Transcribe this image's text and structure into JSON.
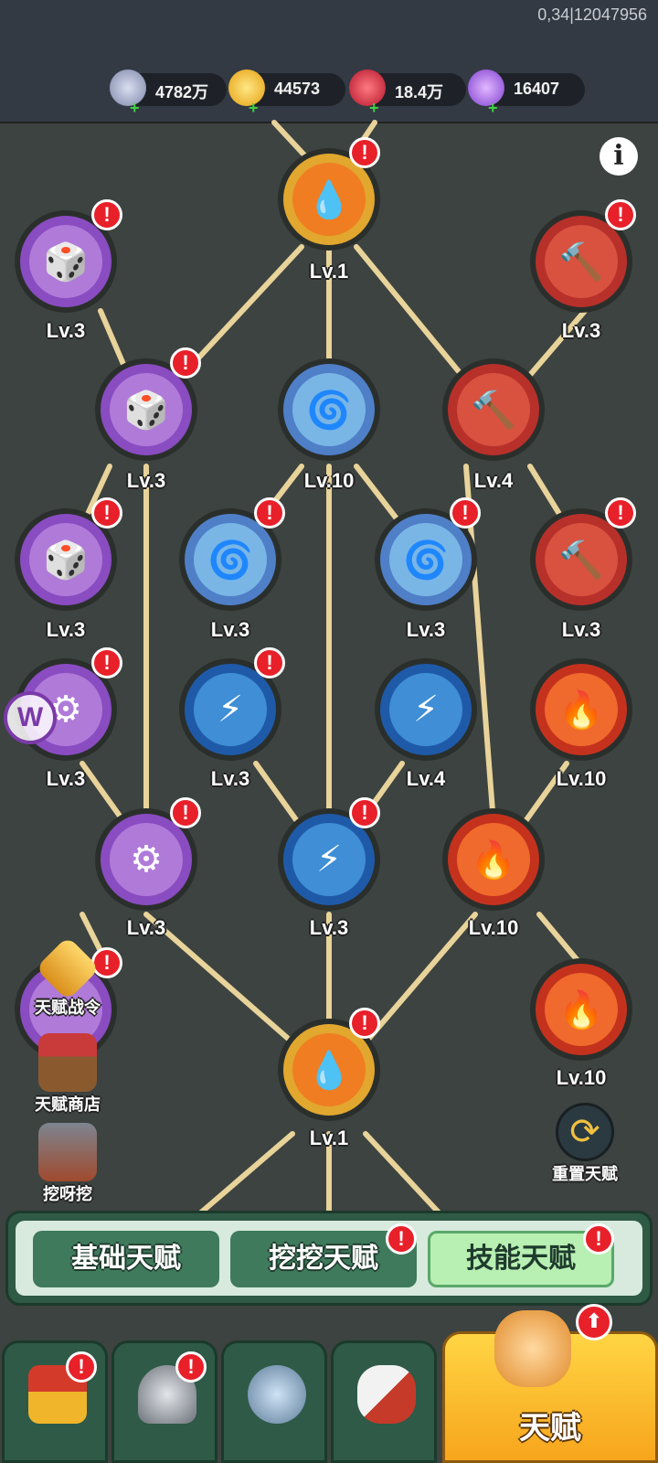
{
  "build_info": "0,34|12047956",
  "currencies": [
    {
      "icon": "silver-coin-icon",
      "value": "4782万",
      "color": "#9aa3c7"
    },
    {
      "icon": "gold-ingot-icon",
      "value": "44573",
      "color": "#f5c21b"
    },
    {
      "icon": "red-gem-icon",
      "value": "18.4万",
      "color": "#d6283a"
    },
    {
      "icon": "purple-crystal-icon",
      "value": "16407",
      "color": "#a35ce0"
    }
  ],
  "info_button": "i",
  "nodes": [
    {
      "id": "top-drop",
      "level": "Lv.1",
      "type": "fire-drop",
      "alert": true
    },
    {
      "id": "dice-l1",
      "level": "Lv.3",
      "type": "dice",
      "alert": true
    },
    {
      "id": "hammer-r1",
      "level": "Lv.3",
      "type": "hammer",
      "alert": true
    },
    {
      "id": "dice-l2",
      "level": "Lv.3",
      "type": "dice",
      "alert": true
    },
    {
      "id": "tornado-c1",
      "level": "Lv.10",
      "type": "tornado",
      "alert": false
    },
    {
      "id": "hammer-r2",
      "level": "Lv.4",
      "type": "hammer",
      "alert": false
    },
    {
      "id": "dice-l3",
      "level": "Lv.3",
      "type": "dice",
      "alert": true
    },
    {
      "id": "tornado-c2",
      "level": "Lv.3",
      "type": "tornado",
      "alert": true
    },
    {
      "id": "tornado-c3",
      "level": "Lv.3",
      "type": "tornado",
      "alert": true
    },
    {
      "id": "hammer-r3",
      "level": "Lv.3",
      "type": "hammer",
      "alert": true
    },
    {
      "id": "mace-l4",
      "level": "Lv.3",
      "type": "mace",
      "alert": true
    },
    {
      "id": "lightning-c4",
      "level": "Lv.3",
      "type": "lightning",
      "alert": true
    },
    {
      "id": "lightning-c5",
      "level": "Lv.4",
      "type": "lightning",
      "alert": false
    },
    {
      "id": "flame-r4",
      "level": "Lv.10",
      "type": "flame",
      "alert": false
    },
    {
      "id": "mace-l5",
      "level": "Lv.3",
      "type": "mace",
      "alert": true
    },
    {
      "id": "lightning-c6",
      "level": "Lv.3",
      "type": "lightning",
      "alert": true
    },
    {
      "id": "flame-r5",
      "level": "Lv.10",
      "type": "flame",
      "alert": false
    },
    {
      "id": "flame-r6",
      "level": "Lv.10",
      "type": "flame",
      "alert": false
    },
    {
      "id": "bottom-drop",
      "level": "Lv.1",
      "type": "fire-drop",
      "alert": true
    },
    {
      "id": "hidden-l6",
      "level": "",
      "type": "mace",
      "alert": true
    }
  ],
  "side_buttons": {
    "talent_pass": "天赋战令",
    "talent_shop": "天赋商店",
    "dig": "挖呀挖",
    "reset": "重置天赋"
  },
  "tabs": [
    {
      "label": "基础天赋",
      "active": false,
      "alert": false
    },
    {
      "label": "挖挖天赋",
      "active": false,
      "alert": true
    },
    {
      "label": "技能天赋",
      "active": true,
      "alert": true
    }
  ],
  "bottom_nav": {
    "talent_label": "天赋",
    "items": [
      {
        "icon": "shrine-icon",
        "alert": true
      },
      {
        "icon": "helmet-icon",
        "alert": true
      },
      {
        "icon": "crest-icon",
        "alert": false
      },
      {
        "icon": "horn-icon",
        "alert": false
      }
    ]
  },
  "watermark": "W",
  "alert_glyph": "!",
  "up_glyph": "⬆"
}
